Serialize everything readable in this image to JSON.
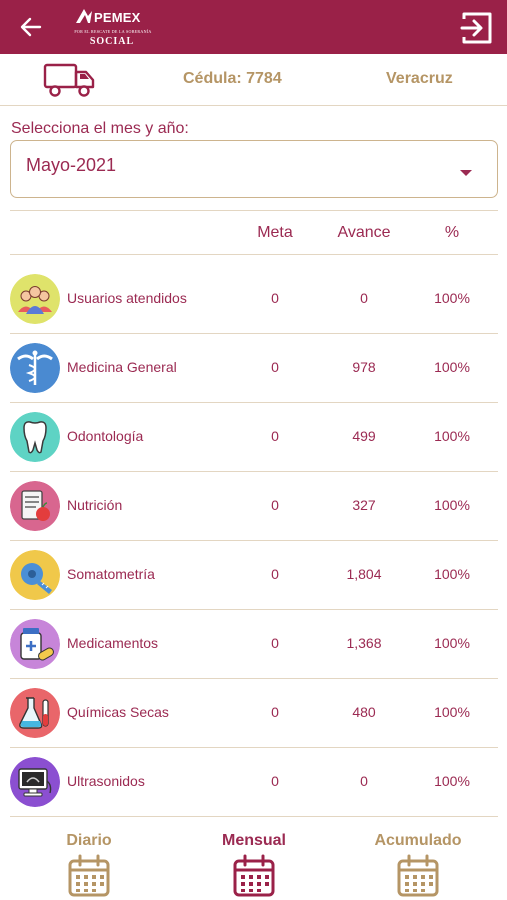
{
  "colors": {
    "brand": "#9a2148",
    "gold": "#b59565",
    "text": "#9b2a52",
    "line": "#e3d6c2"
  },
  "header": {
    "logo_name": "PEMEX",
    "logo_tagline": "POR EL RESCATE DE LA SOBERANÍA",
    "logo_subtitle": "SOCIAL",
    "back_icon": "arrow-left-icon",
    "exit_icon": "logout-icon"
  },
  "info": {
    "cedula": "Cédula: 7784",
    "estado": "Veracruz",
    "vehicle_icon": "truck-icon"
  },
  "selector": {
    "label": "Selecciona el mes y año:",
    "value": "Mayo-2021"
  },
  "table": {
    "headers": {
      "meta": "Meta",
      "avance": "Avance",
      "pct": "%"
    },
    "rows": [
      {
        "icon": "users-icon",
        "label": "Usuarios atendidos",
        "meta": "0",
        "avance": "0",
        "pct": "100%"
      },
      {
        "icon": "caduceus-icon",
        "label": "Medicina General",
        "meta": "0",
        "avance": "978",
        "pct": "100%"
      },
      {
        "icon": "tooth-icon",
        "label": "Odontología",
        "meta": "0",
        "avance": "499",
        "pct": "100%"
      },
      {
        "icon": "nutrition-icon",
        "label": "Nutrición",
        "meta": "0",
        "avance": "327",
        "pct": "100%"
      },
      {
        "icon": "measuring-tape-icon",
        "label": "Somatometría",
        "meta": "0",
        "avance": "1,804",
        "pct": "100%"
      },
      {
        "icon": "medicine-icon",
        "label": "Medicamentos",
        "meta": "0",
        "avance": "1,368",
        "pct": "100%"
      },
      {
        "icon": "flask-icon",
        "label": "Químicas Secas",
        "meta": "0",
        "avance": "480",
        "pct": "100%"
      },
      {
        "icon": "ultrasound-icon",
        "label": "Ultrasonidos",
        "meta": "0",
        "avance": "0",
        "pct": "100%"
      }
    ]
  },
  "tabs": [
    {
      "label": "Diario",
      "active": false
    },
    {
      "label": "Mensual",
      "active": true
    },
    {
      "label": "Acumulado",
      "active": false
    }
  ]
}
